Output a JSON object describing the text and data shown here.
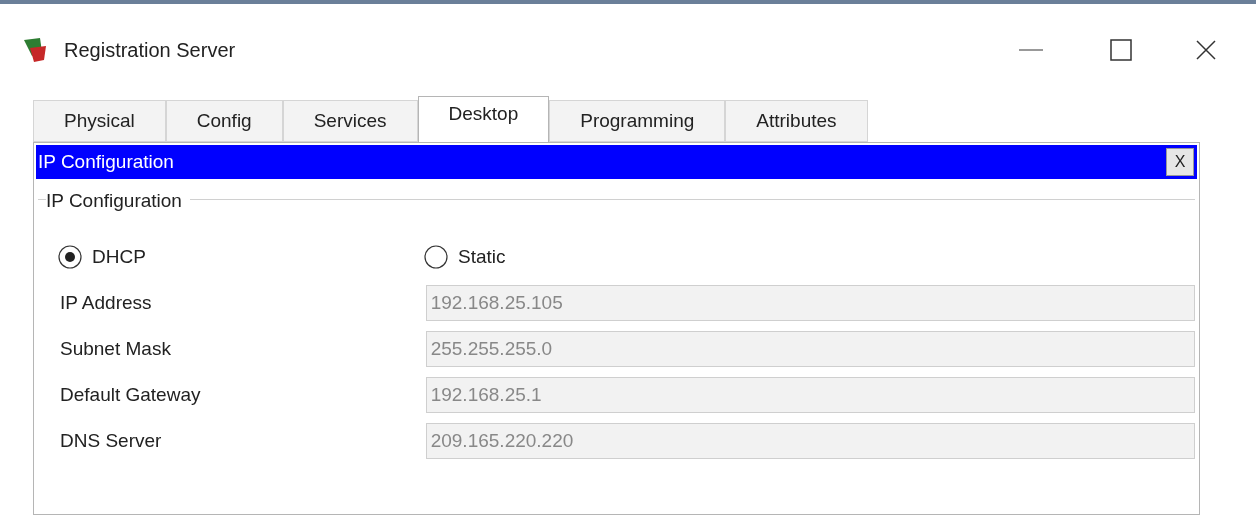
{
  "window": {
    "title": "Registration Server"
  },
  "tabs": [
    {
      "label": "Physical",
      "selected": false
    },
    {
      "label": "Config",
      "selected": false
    },
    {
      "label": "Services",
      "selected": false
    },
    {
      "label": "Desktop",
      "selected": true
    },
    {
      "label": "Programming",
      "selected": false
    },
    {
      "label": "Attributes",
      "selected": false
    }
  ],
  "app_bar": {
    "title": "IP Configuration",
    "close": "X"
  },
  "group": {
    "title": "IP Configuration",
    "modes": [
      {
        "label": "DHCP",
        "selected": true
      },
      {
        "label": "Static",
        "selected": false
      }
    ],
    "fields": [
      {
        "label": "IP Address",
        "value": "192.168.25.105",
        "disabled": true
      },
      {
        "label": "Subnet Mask",
        "value": "255.255.255.0",
        "disabled": true
      },
      {
        "label": "Default Gateway",
        "value": "192.168.25.1",
        "disabled": true
      },
      {
        "label": "DNS Server",
        "value": "209.165.220.220",
        "disabled": true
      }
    ]
  }
}
